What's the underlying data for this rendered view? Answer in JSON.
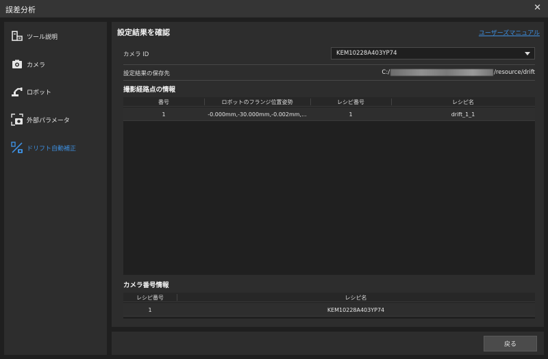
{
  "window": {
    "title": "誤差分析",
    "close_glyph": "✕"
  },
  "sidebar": {
    "items": [
      {
        "label": "ツール説明",
        "icon": "tool-doc-icon"
      },
      {
        "label": "カメラ",
        "icon": "camera-icon"
      },
      {
        "label": "ロボット",
        "icon": "robot-arm-icon"
      },
      {
        "label": "外部パラメータ",
        "icon": "extrinsic-camera-icon"
      },
      {
        "label": "ドリフト自動補正",
        "icon": "drift-correction-icon",
        "active": true
      }
    ]
  },
  "main": {
    "heading": "設定結果を確認",
    "manual_link": "ユーザーズマニュアル",
    "camera_id_label": "カメラ ID",
    "camera_id_value": "KEM10228A403YP74",
    "save_path_label": "設定結果の保存先",
    "save_path_prefix": "C:/",
    "save_path_suffix": "/resource/drift",
    "waypoints": {
      "title": "撮影経路点の情報",
      "columns": [
        "番号",
        "ロボットのフランジ位置姿勢",
        "レシピ番号",
        "レシピ名"
      ],
      "rows": [
        [
          "1",
          "-0.000mm,-30.000mm,-0.002mm,...",
          "1",
          "drift_1_1"
        ]
      ]
    },
    "camera_recipe": {
      "title": "カメラ番号情報",
      "columns": [
        "レシピ番号",
        "レシピ名"
      ],
      "rows": [
        [
          "1",
          "KEM10228A403YP74"
        ]
      ]
    }
  },
  "footer": {
    "back_label": "戻る"
  },
  "colors": {
    "accent": "#3d8fe0",
    "bg": "#1f1f1f",
    "panel": "#2d2d2d"
  }
}
